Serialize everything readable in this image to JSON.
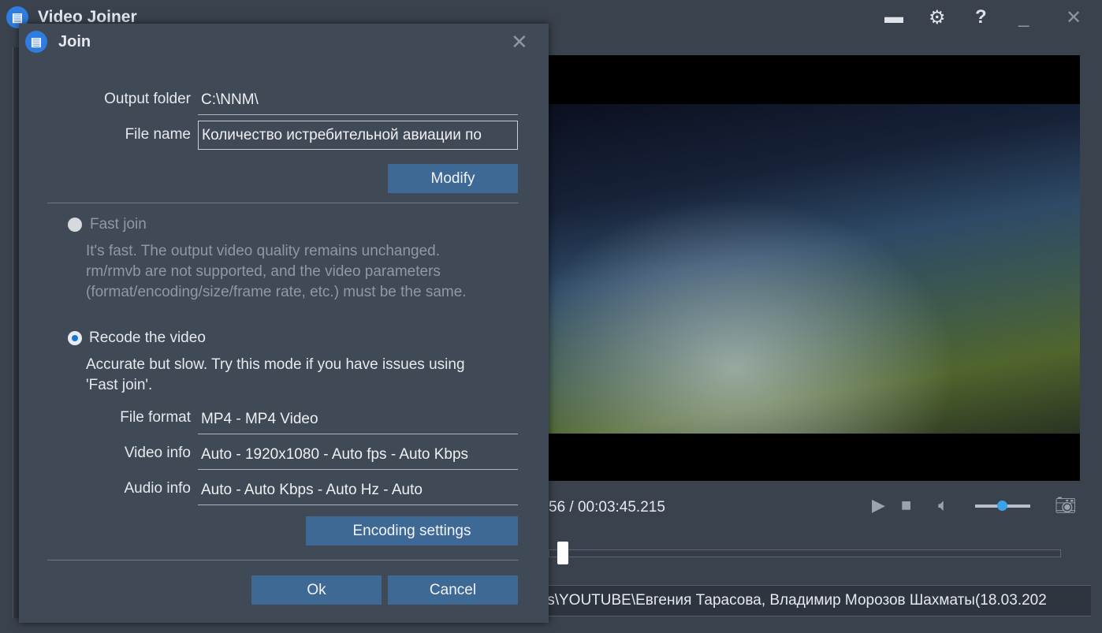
{
  "app": {
    "title": "Video Joiner",
    "toolbar_icons": [
      "folder-icon",
      "gear-icon",
      "help-icon",
      "minimize-icon",
      "close-icon"
    ]
  },
  "player": {
    "time": "56 / 00:03:45.215",
    "seek_fraction": 0.02,
    "volume_fraction": 0.45
  },
  "path_bar": "ls\\YOUTUBE\\Евгения Тарасова, Владимир Морозов Шахматы(18.03.202",
  "dialog": {
    "title": "Join",
    "output_folder_label": "Output folder",
    "output_folder_value": "C:\\NNM\\",
    "file_name_label": "File name",
    "file_name_value": "Количество истребительной авиации по",
    "modify_label": "Modify",
    "fast_join_label": "Fast join",
    "fast_join_desc": [
      "It's fast. The output video quality remains unchanged.",
      "rm/rmvb are not supported, and the video parameters",
      "(format/encoding/size/frame rate, etc.) must be the same."
    ],
    "recode_label": "Recode the video",
    "recode_desc": [
      "Accurate but slow. Try this mode if you have issues using",
      "'Fast join'."
    ],
    "file_format_label": "File format",
    "file_format_value": "MP4 - MP4 Video",
    "video_info_label": "Video info",
    "video_info_value": "Auto - 1920x1080 - Auto fps - Auto Kbps",
    "audio_info_label": "Audio info",
    "audio_info_value": "Auto - Auto Kbps - Auto Hz - Auto",
    "encoding_label": "Encoding settings",
    "ok_label": "Ok",
    "cancel_label": "Cancel",
    "selected_mode": "Recode the video",
    "accent": "#3f6995"
  }
}
